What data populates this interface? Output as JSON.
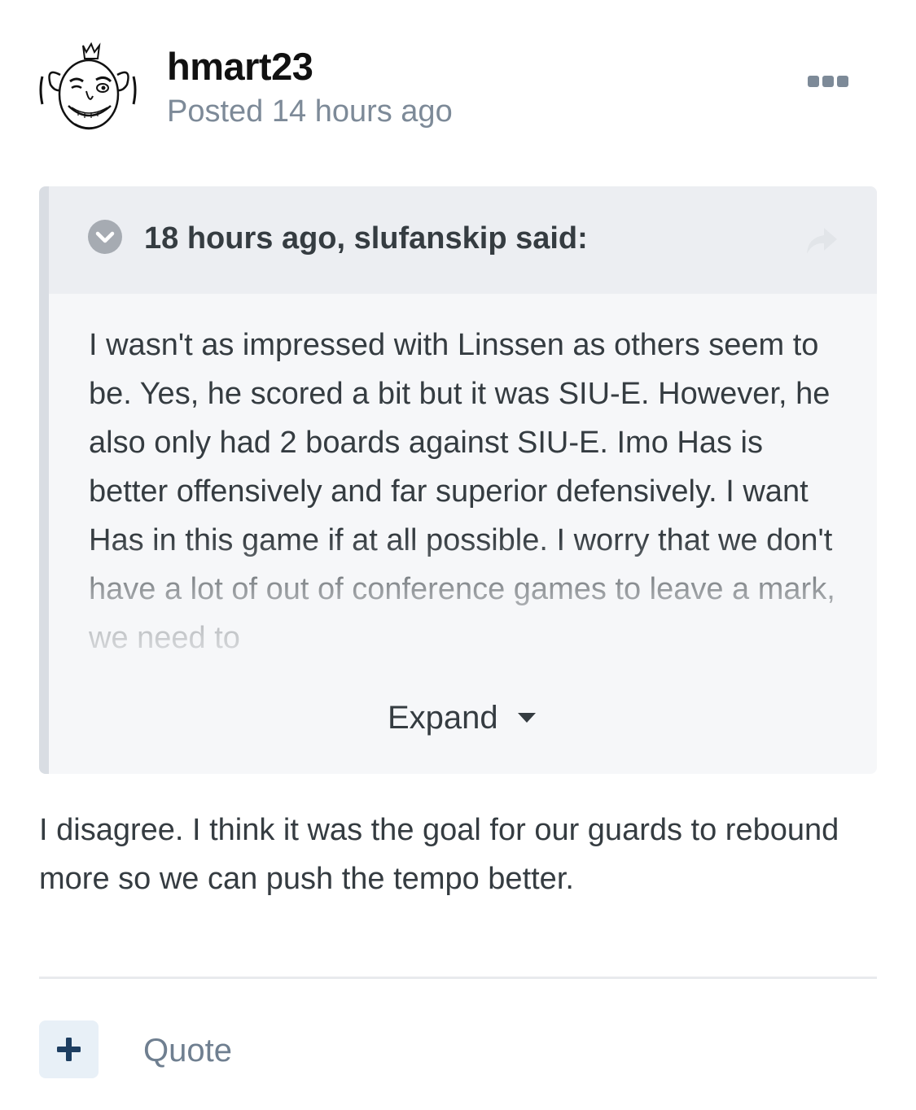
{
  "post": {
    "author": "hmart23",
    "posted": "Posted 14 hours ago",
    "menu_icon": "ellipsis-icon"
  },
  "quote": {
    "citation": "18 hours ago, slufanskip said:",
    "toggle_icon": "chevron-down-circle-icon",
    "share_icon": "share-arrow-icon",
    "text": "I wasn't as impressed with Linssen as others seem to be. Yes, he scored a bit but it was SIU-E. However, he also only had 2 boards against SIU-E. Imo Has is better offensively and far superior defensively. I want Has in this game if at all possible. I worry that we don't have a lot of out of conference games to leave a mark, we need to",
    "expand_label": "Expand",
    "expand_icon": "caret-down-icon"
  },
  "content": {
    "text": "I disagree. I think it was the goal for our guards to rebound more so we can push the tempo better."
  },
  "footer": {
    "plus_icon": "plus-icon",
    "quote_label": "Quote"
  },
  "colors": {
    "author": "#111111",
    "meta": "#7d8a98",
    "body_text": "#353c41",
    "quote_bg": "#f6f7f9",
    "quote_header_bg": "#eceef2",
    "quote_bar": "#d9dde3",
    "plus_button_bg": "#e8f0f7",
    "plus_icon": "#1d3e61"
  }
}
